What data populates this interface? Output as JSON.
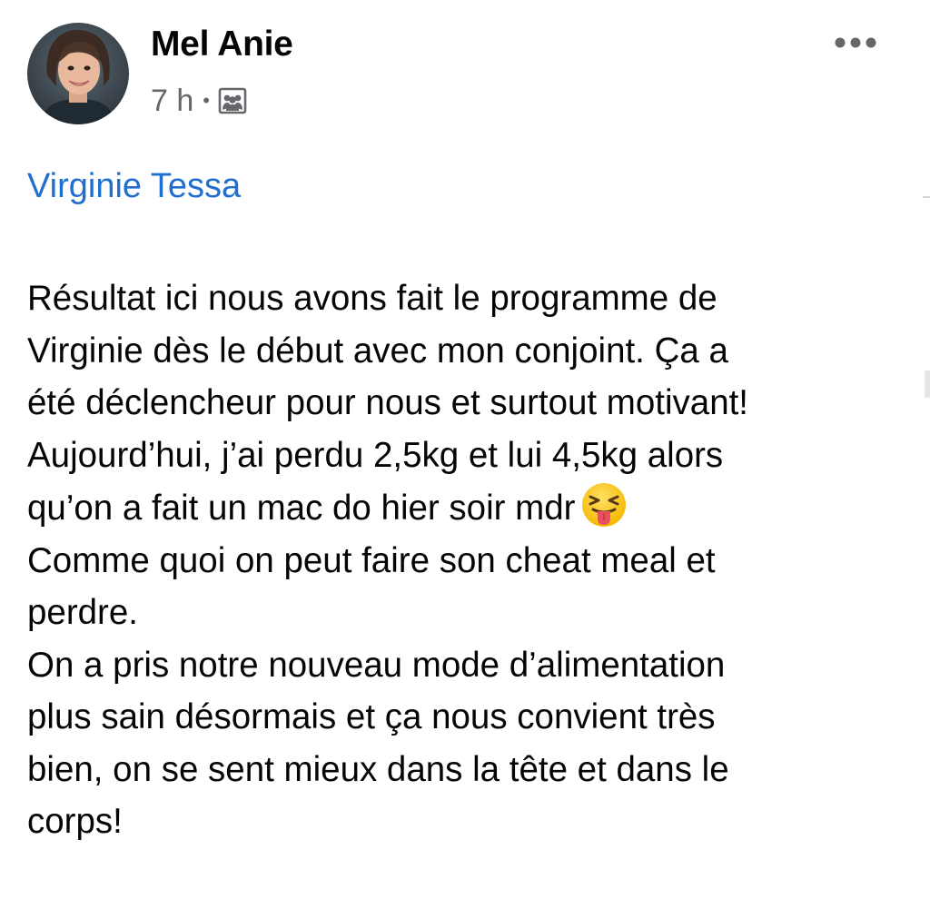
{
  "post": {
    "author": "Mel Anie",
    "time": "7 h",
    "separator": "•",
    "audience_icon": "group-audience-icon",
    "more_icon": "more-options-icon",
    "tagged_user": "Virginie Tessa",
    "lines": [
      "Résultat ici nous avons fait le programme de",
      "Virginie dès le début avec mon conjoint. Ça a",
      "été déclencheur pour nous et surtout motivant!",
      "Aujourd’hui, j’ai perdu 2,5kg et lui 4,5kg alors",
      "qu’on a fait un mac do hier soir mdr",
      "Comme quoi on peut faire son cheat meal et",
      "perdre.",
      "On a pris notre nouveau mode d’alimentation",
      "plus sain désormais et ça nous convient très",
      "bien, on se sent mieux dans la tête et dans le",
      "corps!"
    ],
    "emoji": "squinting-tongue-emoji"
  },
  "colors": {
    "link": "#1f6fd1",
    "text": "#050505",
    "secondary": "#65676b"
  }
}
